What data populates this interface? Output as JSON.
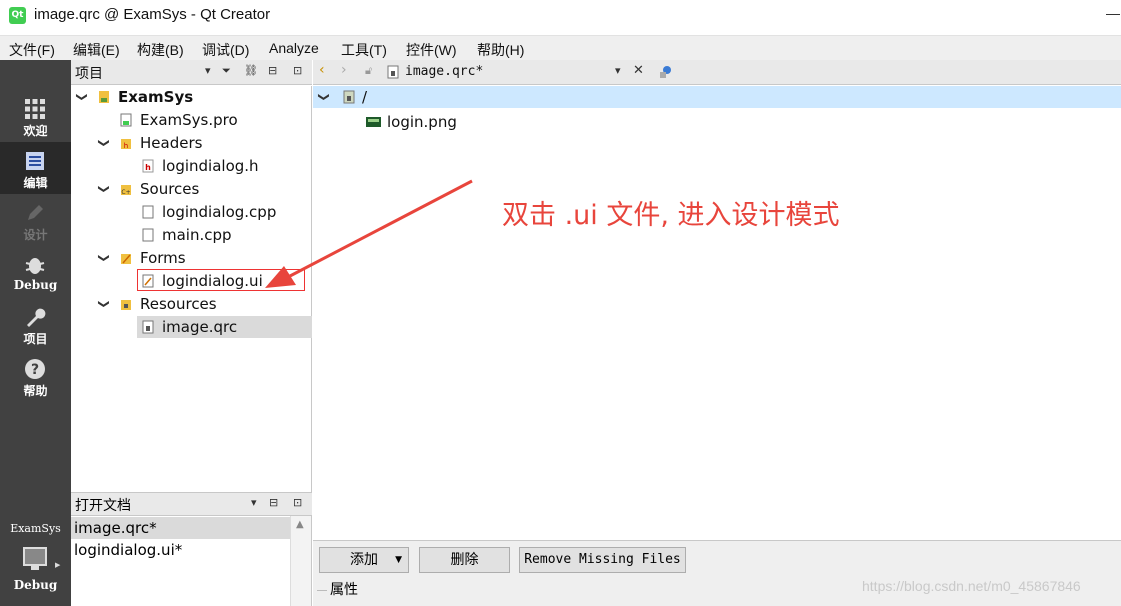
{
  "window": {
    "title": "image.qrc @ ExamSys - Qt Creator",
    "app_icon_text": "Qt"
  },
  "menu": [
    "文件(F)",
    "编辑(E)",
    "构建(B)",
    "调试(D)",
    "Analyze",
    "工具(T)",
    "控件(W)",
    "帮助(H)"
  ],
  "modes": [
    {
      "label": "欢迎",
      "icon": "grid-icon"
    },
    {
      "label": "编辑",
      "icon": "edit-document-icon",
      "active": true
    },
    {
      "label": "设计",
      "icon": "pencil-icon",
      "disabled": true
    },
    {
      "label": "Debug",
      "icon": "bug-icon"
    },
    {
      "label": "项目",
      "icon": "wrench-icon"
    },
    {
      "label": "帮助",
      "icon": "help-icon"
    }
  ],
  "kit": {
    "name": "ExamSys",
    "mode": "Debug"
  },
  "project_panel": {
    "title": "项目",
    "tree": {
      "root": "ExamSys",
      "pro_file": "ExamSys.pro",
      "headers": {
        "label": "Headers",
        "files": [
          "logindialog.h"
        ]
      },
      "sources": {
        "label": "Sources",
        "files": [
          "logindialog.cpp",
          "main.cpp"
        ]
      },
      "forms": {
        "label": "Forms",
        "files": [
          "logindialog.ui"
        ]
      },
      "resources": {
        "label": "Resources",
        "files": [
          "image.qrc"
        ]
      }
    }
  },
  "open_docs": {
    "title": "打开文档",
    "items": [
      "image.qrc*",
      "logindialog.ui*"
    ]
  },
  "editor": {
    "file": "image.qrc*",
    "resource_root": "/",
    "resource_files": [
      "login.png"
    ]
  },
  "annotation": "双击 .ui 文件, 进入设计模式",
  "buttons": {
    "add": "添加",
    "remove": "删除",
    "remove_missing": "Remove Missing Files"
  },
  "properties_label": "属性",
  "watermark": "https://blog.csdn.net/m0_45867846",
  "colors": {
    "selection": "#cde8ff",
    "annotation": "#e8453c",
    "sidebar": "#414141"
  }
}
